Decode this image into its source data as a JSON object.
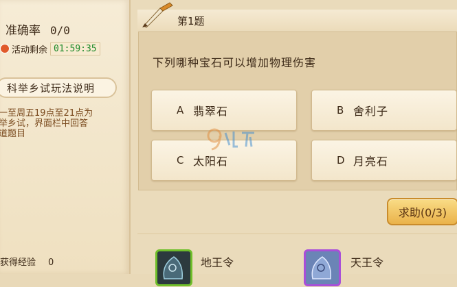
{
  "left_panel": {
    "accuracy_label": "准确率",
    "accuracy_value": "0/0",
    "time_label": "活动剩余",
    "time_value": "01:59:35",
    "howto_button": "科举乡试玩法说明",
    "description_lines": [
      "一至周五19点至21点为",
      "举乡试，界面栏中回答",
      "道题目"
    ],
    "exp_label": "获得经验",
    "exp_value": "0"
  },
  "question": {
    "number": "第1题",
    "text": "下列哪种宝石可以增加物理伤害",
    "options": [
      {
        "letter": "A",
        "text": "翡翠石"
      },
      {
        "letter": "B",
        "text": "舍利子"
      },
      {
        "letter": "C",
        "text": "太阳石"
      },
      {
        "letter": "D",
        "text": "月亮石"
      }
    ]
  },
  "help_button": "求助(0/3)",
  "rewards": [
    {
      "name": "地王令",
      "icon": "green-token-icon"
    },
    {
      "name": "天王令",
      "icon": "purple-token-icon"
    }
  ],
  "colors": {
    "accent_green": "#1d8a2a",
    "help_button": "#eab24a"
  }
}
